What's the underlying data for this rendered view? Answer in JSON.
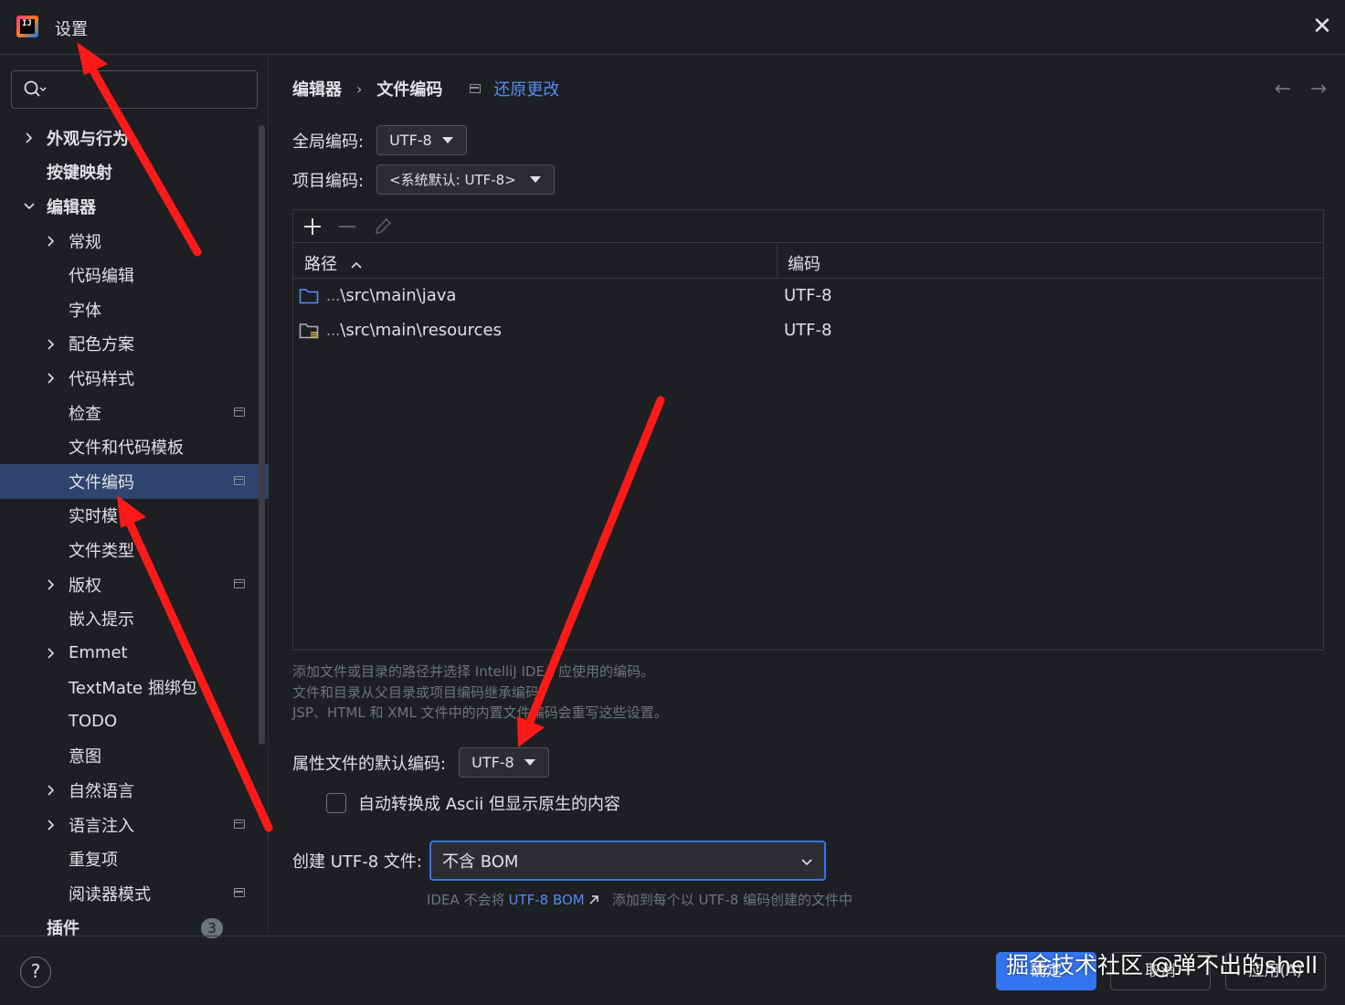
{
  "window": {
    "title": "设置",
    "close_glyph": "✕"
  },
  "search": {
    "placeholder": "",
    "value": ""
  },
  "sidebar": {
    "items": [
      {
        "label": "外观与行为",
        "level": 0,
        "chevron": "right",
        "bold": true,
        "tab": false
      },
      {
        "label": "按键映射",
        "level": 0,
        "chevron": "none",
        "bold": true,
        "tab": false
      },
      {
        "label": "编辑器",
        "level": 0,
        "chevron": "down",
        "bold": true,
        "tab": false
      },
      {
        "label": "常规",
        "level": 1,
        "chevron": "right",
        "bold": false,
        "tab": false
      },
      {
        "label": "代码编辑",
        "level": 1,
        "chevron": "none",
        "bold": false,
        "tab": false
      },
      {
        "label": "字体",
        "level": 1,
        "chevron": "none",
        "bold": false,
        "tab": false
      },
      {
        "label": "配色方案",
        "level": 1,
        "chevron": "right",
        "bold": false,
        "tab": false
      },
      {
        "label": "代码样式",
        "level": 1,
        "chevron": "right",
        "bold": false,
        "tab": false
      },
      {
        "label": "检查",
        "level": 1,
        "chevron": "none",
        "bold": false,
        "tab": true
      },
      {
        "label": "文件和代码模板",
        "level": 1,
        "chevron": "none",
        "bold": false,
        "tab": false
      },
      {
        "label": "文件编码",
        "level": 1,
        "chevron": "none",
        "bold": false,
        "tab": true,
        "selected": true
      },
      {
        "label": "实时模",
        "level": 1,
        "chevron": "none",
        "bold": false,
        "tab": false
      },
      {
        "label": "文件类型",
        "level": 1,
        "chevron": "none",
        "bold": false,
        "tab": false
      },
      {
        "label": "版权",
        "level": 1,
        "chevron": "right",
        "bold": false,
        "tab": true
      },
      {
        "label": "嵌入提示",
        "level": 1,
        "chevron": "none",
        "bold": false,
        "tab": false
      },
      {
        "label": "Emmet",
        "level": 1,
        "chevron": "right",
        "bold": false,
        "tab": false
      },
      {
        "label": "TextMate 捆绑包",
        "level": 1,
        "chevron": "none",
        "bold": false,
        "tab": false
      },
      {
        "label": "TODO",
        "level": 1,
        "chevron": "none",
        "bold": false,
        "tab": false
      },
      {
        "label": "意图",
        "level": 1,
        "chevron": "none",
        "bold": false,
        "tab": false
      },
      {
        "label": "自然语言",
        "level": 1,
        "chevron": "right",
        "bold": false,
        "tab": false
      },
      {
        "label": "语言注入",
        "level": 1,
        "chevron": "right",
        "bold": false,
        "tab": true
      },
      {
        "label": "重复项",
        "level": 1,
        "chevron": "none",
        "bold": false,
        "tab": false
      },
      {
        "label": "阅读器模式",
        "level": 1,
        "chevron": "none",
        "bold": false,
        "tab": true
      },
      {
        "label": "插件",
        "level": 0,
        "chevron": "none",
        "bold": true,
        "tab": false,
        "badge": "3"
      }
    ]
  },
  "breadcrumb": {
    "parent": "编辑器",
    "separator": "›",
    "current": "文件编码",
    "reset_label": "还原更改"
  },
  "nav": {
    "back": "←",
    "forward": "→"
  },
  "global_encoding": {
    "label": "全局编码:",
    "value": "UTF-8"
  },
  "project_encoding": {
    "label": "项目编码:",
    "value": "<系统默认: UTF-8>"
  },
  "table": {
    "col_path": "路径",
    "col_encoding": "编码",
    "rows": [
      {
        "prefix": "...",
        "path": "\\src\\main\\java",
        "encoding": "UTF-8"
      },
      {
        "prefix": "...",
        "path": "\\src\\main\\resources",
        "encoding": "UTF-8"
      }
    ]
  },
  "help": {
    "line1": "添加文件或目录的路径并选择 IntelliJ IDEA 应使用的编码。",
    "line2": "文件和目录从父目录或项目编码继承编码。",
    "line3": "JSP、HTML 和 XML 文件中的内置文件编码会重写这些设置。"
  },
  "properties_encoding": {
    "label": "属性文件的默认编码:",
    "value": "UTF-8"
  },
  "ascii_checkbox": {
    "label": "自动转换成 Ascii 但显示原生的内容",
    "checked": false
  },
  "utf8_bom": {
    "label": "创建 UTF-8 文件:",
    "value": "不含 BOM",
    "note_prefix": "IDEA 不会将",
    "note_link": "UTF-8 BOM",
    "note_suffix": "添加到每个以 UTF-8 编码创建的文件中"
  },
  "footer": {
    "help": "?",
    "ok": "确定",
    "cancel": "取消",
    "apply": "应用(A)"
  },
  "watermark": "掘金技术社区 @弹不出的shell",
  "colors": {
    "accent": "#3574f0",
    "link": "#548af7",
    "selection": "#2e436e",
    "annotation_arrow": "#ff1a1a"
  }
}
